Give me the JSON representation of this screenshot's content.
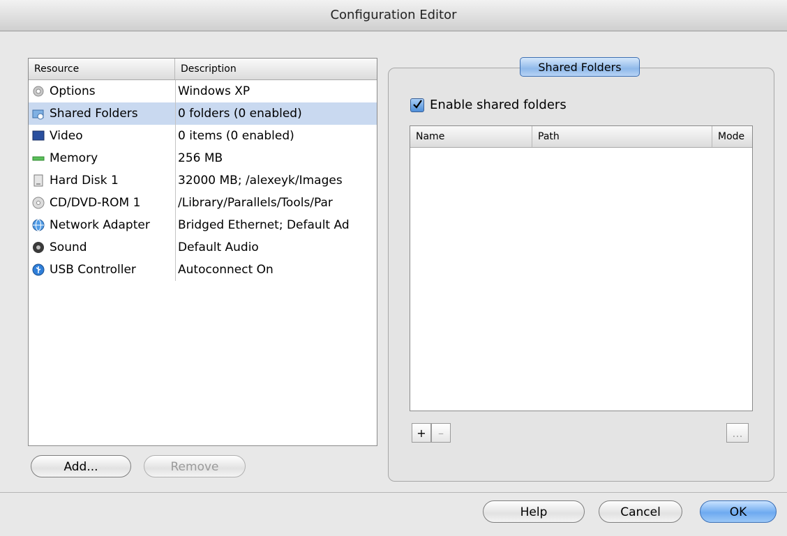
{
  "window": {
    "title": "Configuration Editor"
  },
  "resources": {
    "headers": {
      "resource": "Resource",
      "description": "Description"
    },
    "rows": [
      {
        "name": "Options",
        "description": "Windows XP",
        "icon": "gear-icon"
      },
      {
        "name": "Shared Folders",
        "description": "0 folders (0 enabled)",
        "icon": "shared-folder-icon",
        "selected": true
      },
      {
        "name": "Video",
        "description": "0 items (0 enabled)",
        "icon": "monitor-icon"
      },
      {
        "name": "Memory",
        "description": "256 MB",
        "icon": "memory-icon"
      },
      {
        "name": "Hard Disk 1",
        "description": "32000 MB; /alexeyk/Images",
        "icon": "hard-disk-icon"
      },
      {
        "name": "CD/DVD-ROM 1",
        "description": "/Library/Parallels/Tools/Par",
        "icon": "cd-icon"
      },
      {
        "name": "Network Adapter",
        "description": "Bridged Ethernet; Default Ad",
        "icon": "network-icon"
      },
      {
        "name": "Sound",
        "description": "Default Audio",
        "icon": "speaker-icon"
      },
      {
        "name": "USB Controller",
        "description": "Autoconnect On",
        "icon": "usb-icon"
      }
    ],
    "add_label": "Add...",
    "remove_label": "Remove"
  },
  "shared_folders": {
    "group_title": "Shared Folders",
    "enable_label": "Enable shared folders",
    "enable_checked": true,
    "columns": {
      "name": "Name",
      "path": "Path",
      "mode": "Mode"
    },
    "plus_label": "+",
    "minus_label": "–",
    "more_label": "..."
  },
  "footer": {
    "help_label": "Help",
    "cancel_label": "Cancel",
    "ok_label": "OK"
  }
}
